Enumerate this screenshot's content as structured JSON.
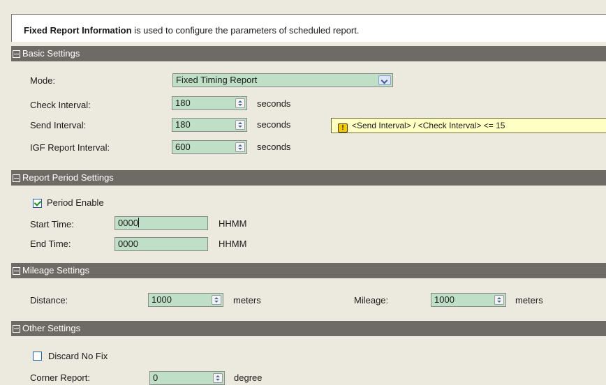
{
  "intro": {
    "bold": "Fixed Report Information",
    "rest": " is used to configure the parameters of scheduled report."
  },
  "basic": {
    "header": "Basic Settings",
    "mode_label": "Mode:",
    "mode_value": "Fixed Timing Report",
    "check_label": "Check Interval:",
    "check_value": "180",
    "send_label": "Send Interval:",
    "send_value": "180",
    "igf_label": "IGF Report Interval:",
    "igf_value": "600",
    "unit": "seconds",
    "tip": "<Send Interval> / <Check Interval> <= 15",
    "tip_icon": "!"
  },
  "period": {
    "header": "Report Period Settings",
    "enable_label": "Period Enable",
    "enable_checked": true,
    "start_label": "Start Time:",
    "start_value": "0000",
    "end_label": "End Time:",
    "end_value": "0000",
    "unit": "HHMM"
  },
  "mileage": {
    "header": "Mileage Settings",
    "distance_label": "Distance:",
    "distance_value": "1000",
    "mileage_label": "Mileage:",
    "mileage_value": "1000",
    "unit": "meters"
  },
  "other": {
    "header": "Other Settings",
    "discard_label": "Discard No Fix",
    "discard_checked": false,
    "corner_label": "Corner Report:",
    "corner_value": "0",
    "corner_unit": "degree"
  }
}
